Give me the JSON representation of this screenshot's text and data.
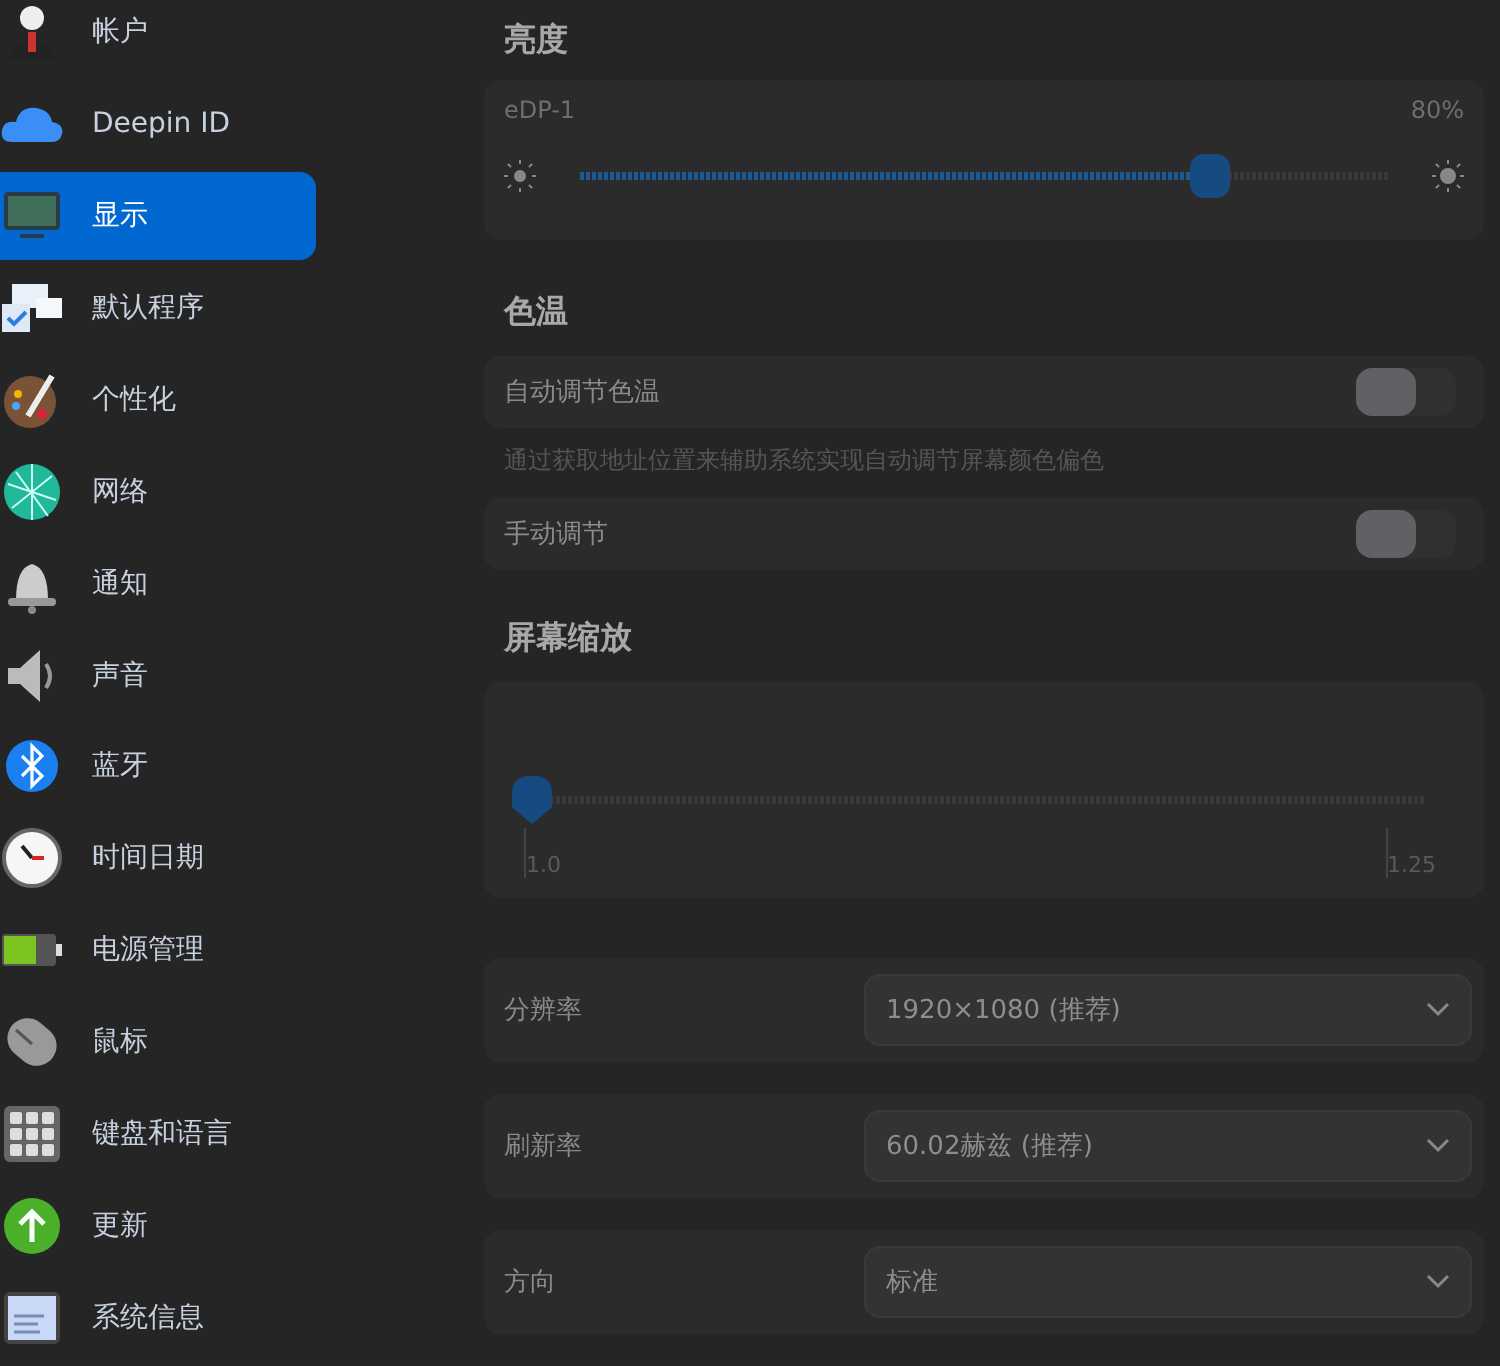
{
  "sidebar": {
    "items": [
      {
        "label": "帐户",
        "selected": false
      },
      {
        "label": "Deepin ID",
        "selected": false
      },
      {
        "label": "显示",
        "selected": true
      },
      {
        "label": "默认程序",
        "selected": false
      },
      {
        "label": "个性化",
        "selected": false
      },
      {
        "label": "网络",
        "selected": false
      },
      {
        "label": "通知",
        "selected": false
      },
      {
        "label": "声音",
        "selected": false
      },
      {
        "label": "蓝牙",
        "selected": false
      },
      {
        "label": "时间日期",
        "selected": false
      },
      {
        "label": "电源管理",
        "selected": false
      },
      {
        "label": "鼠标",
        "selected": false
      },
      {
        "label": "键盘和语言",
        "selected": false
      },
      {
        "label": "更新",
        "selected": false
      },
      {
        "label": "系统信息",
        "selected": false
      }
    ]
  },
  "brightness": {
    "title": "亮度",
    "display": "eDP-1",
    "reading": "80%",
    "level": 0.78
  },
  "color_temperature": {
    "title": "色温",
    "auto": {
      "label": "自动调节色温",
      "on": false
    },
    "hint": "通过获取地址位置来辅助系统实现自动调节屏幕颜色偏色",
    "manual": {
      "label": "手动调节",
      "on": false
    }
  },
  "scaling": {
    "title": "屏幕缩放",
    "level": 0,
    "min_label": "1.0",
    "max_label": "1.25"
  },
  "settings": [
    {
      "label": "分辨率",
      "value": "1920×1080 (推荐)"
    },
    {
      "label": "刷新率",
      "value": "60.02赫兹 (推荐)"
    },
    {
      "label": "方向",
      "value": "标准"
    }
  ]
}
